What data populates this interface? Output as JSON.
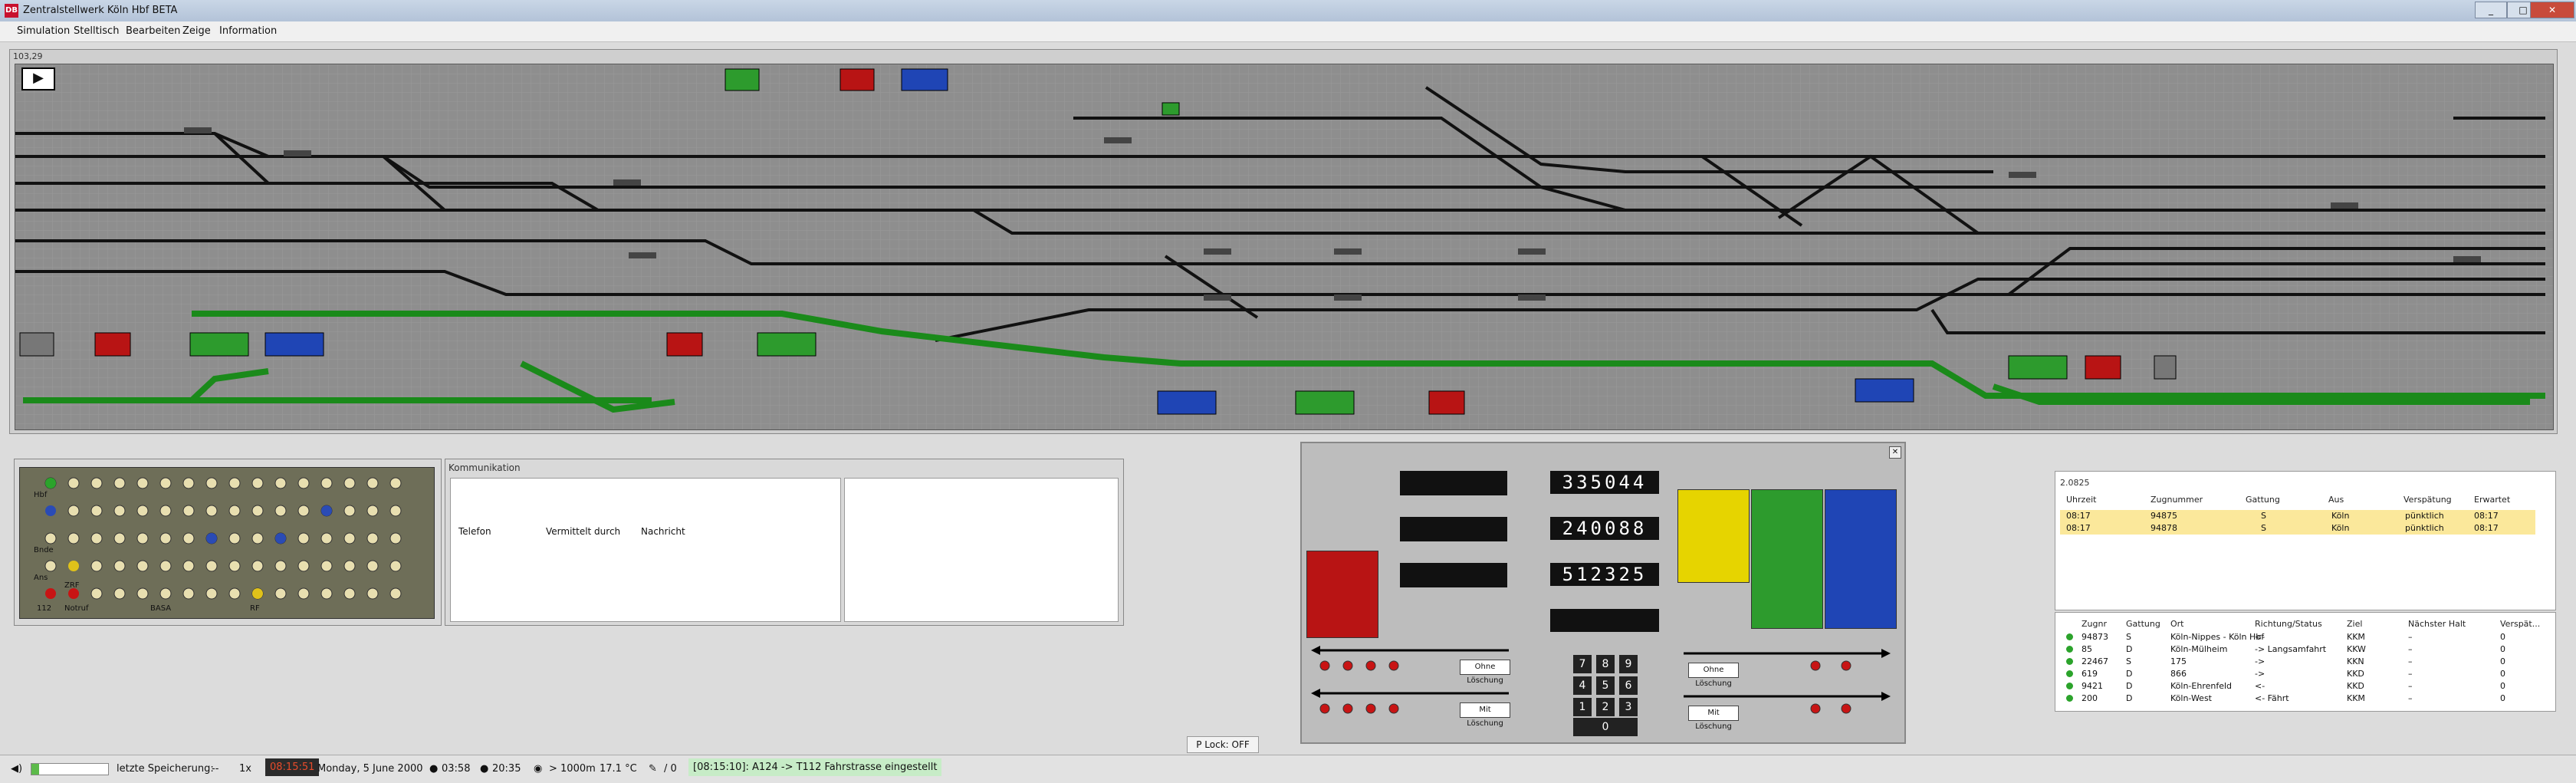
{
  "window": {
    "title": "Zentralstellwerk Köln Hbf BETA",
    "icon": "db-logo-icon",
    "min": "_",
    "max": "□",
    "close": "✕"
  },
  "menu": [
    "Simulation",
    "Stelltisch",
    "Bearbeiten",
    "Zeige",
    "Information"
  ],
  "panel": {
    "coord": "103,29",
    "direction_arrow": "▶"
  },
  "lampboard": {
    "labels": [
      "Hbf",
      "Bnde",
      "Ans",
      "ZRF",
      "112",
      "Notruf",
      "BASA",
      "RF"
    ]
  },
  "kommunikation": {
    "title": "Kommunikation",
    "columns": [
      "Telefon",
      "Vermittelt durch",
      "Nachricht"
    ]
  },
  "stelltisch": {
    "counters": [
      "335044",
      "240088",
      "512325"
    ],
    "keypad": [
      "7",
      "8",
      "9",
      "4",
      "5",
      "6",
      "1",
      "2",
      "3",
      "0"
    ],
    "buttons": [
      "Ohne Löschung",
      "Mit Löschung",
      "Ohne Löschung",
      "Mit Löschung"
    ],
    "colors": {
      "red": "#b81414",
      "yellow": "#e6d400",
      "green": "#2d9b2d",
      "blue": "#1f45b5"
    }
  },
  "zuglist": {
    "id": "2.0825",
    "headers": [
      "Uhrzeit",
      "Zugnummer",
      "Gattung",
      "Aus",
      "Verspätung",
      "Erwartet"
    ],
    "rows": [
      [
        "08:17",
        "94875",
        "S",
        "Köln",
        "pünktlich",
        "08:17"
      ],
      [
        "08:17",
        "94878",
        "S",
        "Köln",
        "pünktlich",
        "08:17"
      ]
    ]
  },
  "trainlist": {
    "headers": [
      "Zugnr",
      "Gattung",
      "Ort",
      "Richtung/Status",
      "Ziel",
      "Nächster Halt",
      "Verspät..."
    ],
    "rows": [
      [
        "94873",
        "S",
        "Köln-Nippes - Köln Hbf",
        "<-",
        "KKM",
        "–",
        "0"
      ],
      [
        "85",
        "D",
        "Köln-Mülheim",
        "-> Langsamfahrt",
        "KKW",
        "–",
        "0"
      ],
      [
        "22467",
        "S",
        "175",
        "->",
        "KKN",
        "–",
        "0"
      ],
      [
        "619",
        "D",
        "866",
        "->",
        "KKD",
        "–",
        "0"
      ],
      [
        "9421",
        "D",
        "Köln-Ehrenfeld",
        "<-",
        "KKD",
        "–",
        "0"
      ],
      [
        "200",
        "D",
        "Köln-West",
        "<- Fährt",
        "KKM",
        "–",
        "0"
      ]
    ]
  },
  "statusbar": {
    "save_label": "letzte Speicherung:",
    "save_value": "--",
    "speed": "1x",
    "time": "08:15:51",
    "date": "Monday, 5 June 2000",
    "sunrise": "03:58",
    "sunset": "20:35",
    "visibility": "> 1000m",
    "temperature": "17.1 °C",
    "count": "/ 0",
    "message": "[08:15:10]: A124 -> T112 Fahrstrasse eingestellt",
    "plock": "P Lock: OFF"
  }
}
